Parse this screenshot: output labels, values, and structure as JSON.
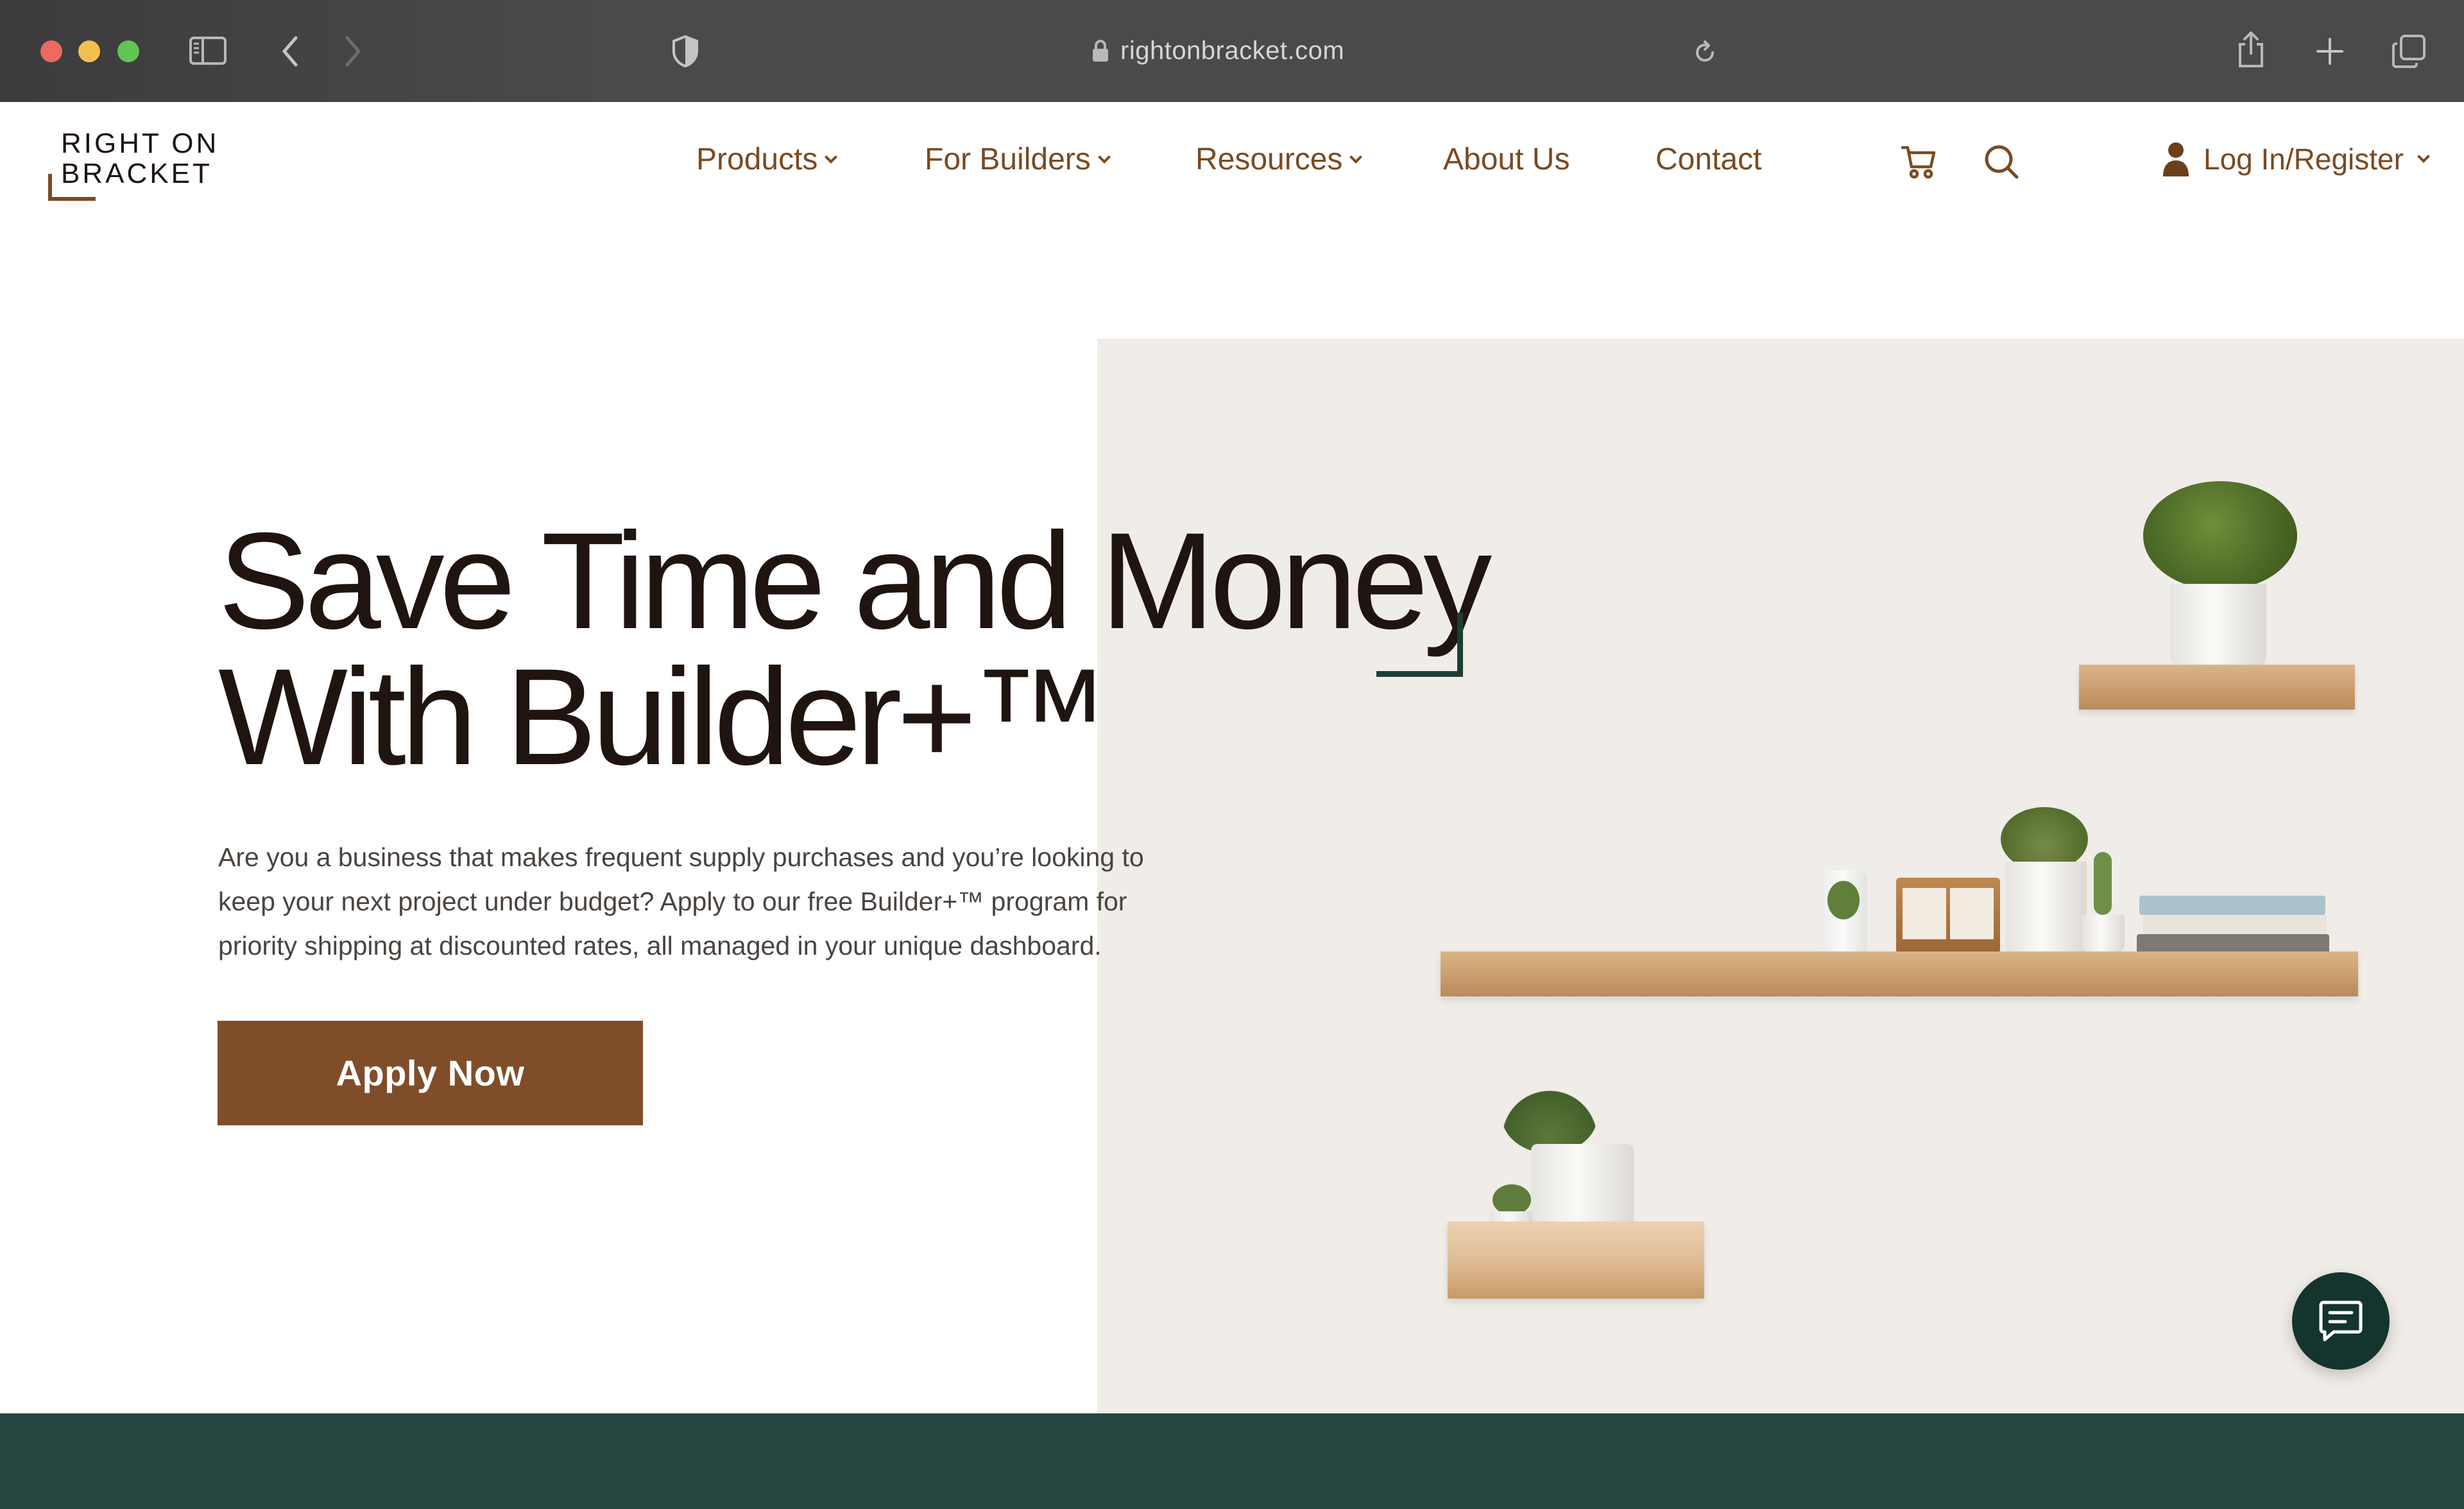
{
  "browser": {
    "url": "rightonbracket.com"
  },
  "site": {
    "logo": {
      "line1": "RIGHT ON",
      "line2": "BRACKET"
    },
    "nav": [
      {
        "label": "Products",
        "has_dropdown": true
      },
      {
        "label": "For Builders",
        "has_dropdown": true
      },
      {
        "label": "Resources",
        "has_dropdown": true
      },
      {
        "label": "About Us",
        "has_dropdown": false
      },
      {
        "label": "Contact",
        "has_dropdown": false
      }
    ],
    "account_label": "Log In/Register"
  },
  "hero": {
    "headline_line1": "Save Time and Money",
    "headline_line2": "With Builder+™",
    "body": "Are you a business that makes frequent supply purchases and you’re looking to keep your next project under budget? Apply to our free Builder+™ program for priority shipping at discounted rates, all managed in your unique dashboard.",
    "cta_label": "Apply Now"
  },
  "colors": {
    "brand_brown": "#7f4d2a",
    "nav_text": "#7a4a22",
    "dark_green": "#264540",
    "hero_panel": "#f0ece8"
  },
  "icons": [
    "sidebar-icon",
    "back-icon",
    "forward-icon",
    "shield-icon",
    "lock-icon",
    "reload-icon",
    "share-icon",
    "new-tab-icon",
    "tabs-icon",
    "cart-icon",
    "search-icon",
    "user-icon",
    "chat-icon"
  ]
}
